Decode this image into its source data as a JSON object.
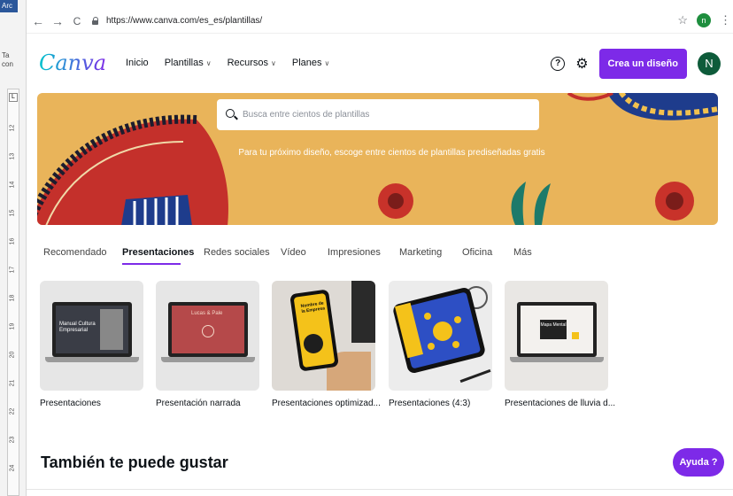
{
  "word": {
    "tab_label": "Arc",
    "left_text_1": "Ta",
    "left_text_2": "con"
  },
  "browser": {
    "url": "https://www.canva.com/es_es/plantillas/",
    "back_icon": "←",
    "forward_icon": "→",
    "reload_icon": "C",
    "star_icon": "☆",
    "extension_label": "n",
    "menu_icon": "⋮"
  },
  "header": {
    "logo": "Canva",
    "menu": [
      {
        "label": "Inicio",
        "has_dropdown": false
      },
      {
        "label": "Plantillas",
        "has_dropdown": true
      },
      {
        "label": "Recursos",
        "has_dropdown": true
      },
      {
        "label": "Planes",
        "has_dropdown": true
      }
    ],
    "help_icon": "?",
    "settings_icon": "⚙",
    "create_label": "Crea un diseño",
    "avatar_initial": "N",
    "accent": "#7d2ae8"
  },
  "hero": {
    "search_placeholder": "Busca entre cientos de plantillas",
    "subtitle": "Para tu próximo diseño, escoge entre cientos de plantillas prediseñadas gratis"
  },
  "tabs": [
    "Recomendado",
    "Presentaciones",
    "Redes sociales",
    "Vídeo",
    "Impresiones",
    "Marketing",
    "Oficina",
    "Más"
  ],
  "active_tab": "Presentaciones",
  "cards": [
    {
      "label": "Presentaciones",
      "thumb_text": "Manual Cultura Empresarial"
    },
    {
      "label": "Presentación narrada",
      "thumb_text": "Lucas & Pale"
    },
    {
      "label": "Presentaciones optimizad...",
      "thumb_text": "Nombre de la Empresa"
    },
    {
      "label": "Presentaciones (4:3)",
      "thumb_text": ""
    },
    {
      "label": "Presentaciones de lluvia d...",
      "thumb_text": "Mapa Mental"
    }
  ],
  "section_title": "También te puede gustar",
  "help_button": "Ayuda ?",
  "ruler_numbers": [
    "12",
    "13",
    "14",
    "15",
    "16",
    "17",
    "18",
    "19",
    "20",
    "21",
    "22",
    "23",
    "24"
  ]
}
